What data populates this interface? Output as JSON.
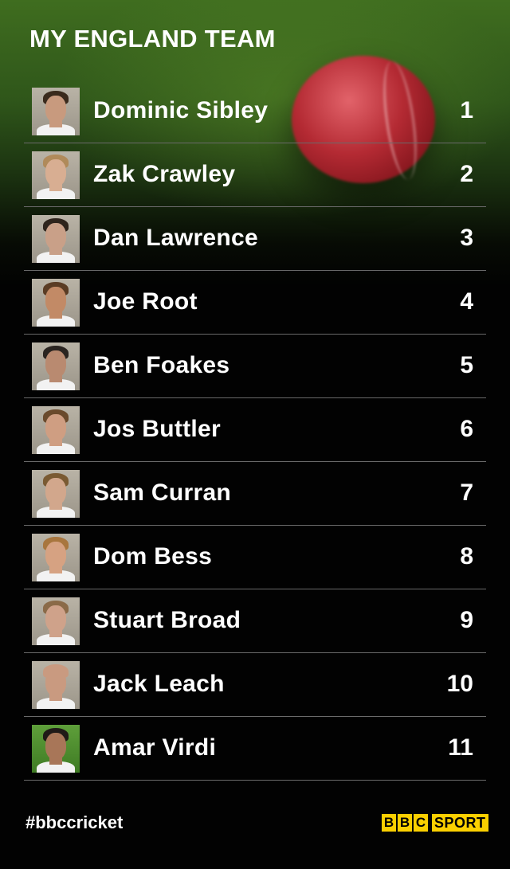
{
  "title": "MY ENGLAND TEAM",
  "players": [
    {
      "name": "Dominic Sibley",
      "number": "1",
      "skin": "#c89a7e",
      "hair": "#3a2a1c"
    },
    {
      "name": "Zak Crawley",
      "number": "2",
      "skin": "#d8ae92",
      "hair": "#b08a5a"
    },
    {
      "name": "Dan Lawrence",
      "number": "3",
      "skin": "#c9a088",
      "hair": "#2e241c"
    },
    {
      "name": "Joe Root",
      "number": "4",
      "skin": "#c28a66",
      "hair": "#5a3c24"
    },
    {
      "name": "Ben Foakes",
      "number": "5",
      "skin": "#b98a70",
      "hair": "#2a2420"
    },
    {
      "name": "Jos Buttler",
      "number": "6",
      "skin": "#cf9e82",
      "hair": "#6a4a2c"
    },
    {
      "name": "Sam Curran",
      "number": "7",
      "skin": "#d2a78c",
      "hair": "#7a5a32"
    },
    {
      "name": "Dom Bess",
      "number": "8",
      "skin": "#d6a282",
      "hair": "#a8763e"
    },
    {
      "name": "Stuart Broad",
      "number": "9",
      "skin": "#cfa28a",
      "hair": "#8a6a48"
    },
    {
      "name": "Jack Leach",
      "number": "10",
      "skin": "#c99a80",
      "hair": "#c99a80"
    },
    {
      "name": "Amar Virdi",
      "number": "11",
      "skin": "#a87658",
      "hair": "#1f1a17"
    }
  ],
  "footer": {
    "hashtag": "#bbccricket",
    "logo_letters": [
      "B",
      "B",
      "C"
    ],
    "logo_sport": "SPORT",
    "logo_color": "#fbd000"
  }
}
